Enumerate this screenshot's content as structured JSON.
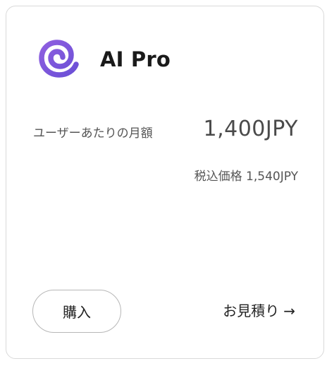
{
  "plan": {
    "name": "AI Pro",
    "logo_icon": "swirl-logo-icon",
    "logo_color": "#7f57dc"
  },
  "pricing": {
    "label": "ユーザーあたりの月額",
    "price": "1,400JPY",
    "tax_included": "税込価格 1,540JPY"
  },
  "actions": {
    "buy_label": "購入",
    "quote_label": "お見積り",
    "quote_arrow": "→"
  }
}
